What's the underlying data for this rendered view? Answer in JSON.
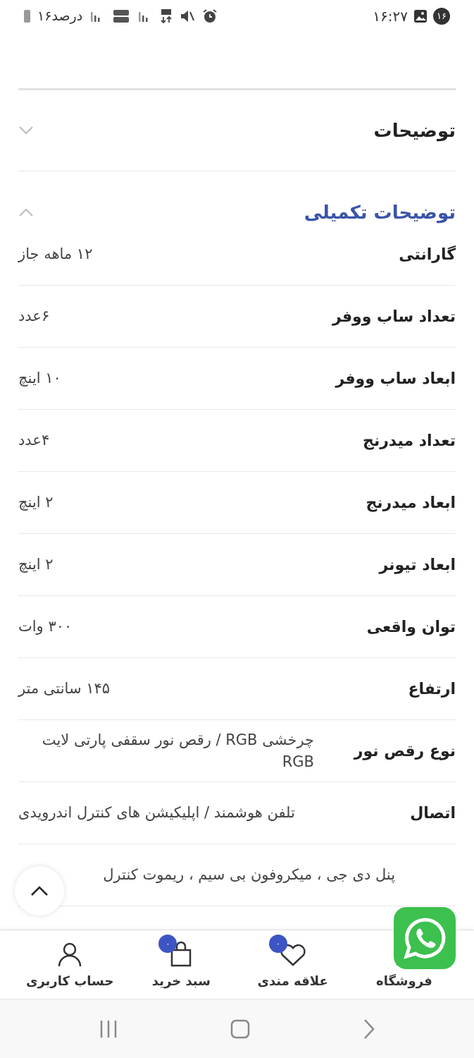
{
  "status_bar": {
    "time": "۱۶:۲۷",
    "notification_count": "۱۶",
    "battery": "۱۶درصد"
  },
  "sections": [
    {
      "title": "توضیحات",
      "expanded": false
    },
    {
      "title": "توضیحات تکمیلی",
      "expanded": true,
      "rows": [
        {
          "label": "گارانتی",
          "value": "۱۲ ماهه جاز"
        },
        {
          "label": "تعداد ساب ووفر",
          "value": "۶عدد"
        },
        {
          "label": "ابعاد ساب ووفر",
          "value": "۱۰ اینچ"
        },
        {
          "label": "تعداد میدرنج",
          "value": "۴عدد"
        },
        {
          "label": "ابعاد میدرنج",
          "value": "۲ اینچ"
        },
        {
          "label": "ابعاد تیونر",
          "value": "۲ اینچ"
        },
        {
          "label": "توان واقعی",
          "value": "۳۰۰ وات"
        },
        {
          "label": "ارتفاع",
          "value": "۱۴۵ سانتی متر"
        },
        {
          "label": "نوع رقص نور",
          "value": "چرخشی RGB / رقص نور سقفی پارتی لایت RGB"
        },
        {
          "label": "اتصال",
          "value": "تلفن هوشمند / اپلیکیشن های کنترل اندرویدی"
        },
        {
          "value": "پنل دی جی ، میکروفون بی سیم ، ریموت کنترل"
        }
      ]
    }
  ],
  "bottom_nav": [
    {
      "kind": "store",
      "label": "فروشگاه"
    },
    {
      "kind": "wishlist",
      "label": "علاقه مندی",
      "badge": "۰"
    },
    {
      "kind": "cart",
      "label": "سبد خرید",
      "badge": "۰"
    },
    {
      "kind": "account",
      "label": "حساب کاربری"
    }
  ]
}
